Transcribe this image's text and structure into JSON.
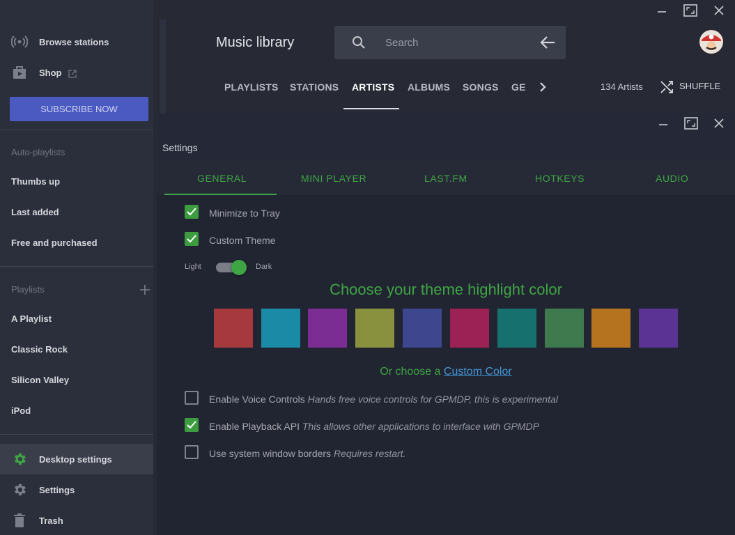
{
  "sidebar": {
    "browse_stations": "Browse stations",
    "shop": "Shop",
    "subscribe": "SUBSCRIBE NOW",
    "auto_playlists_label": "Auto-playlists",
    "auto_playlists": [
      "Thumbs up",
      "Last added",
      "Free and purchased"
    ],
    "playlists_label": "Playlists",
    "playlists": [
      "A Playlist",
      "Classic Rock",
      "Silicon Valley",
      "iPod"
    ],
    "desktop_settings": "Desktop settings",
    "settings": "Settings",
    "trash": "Trash"
  },
  "header": {
    "title": "Music library",
    "search_placeholder": "Search",
    "tabs": [
      "PLAYLISTS",
      "STATIONS",
      "ARTISTS",
      "ALBUMS",
      "SONGS",
      "GE"
    ],
    "active_tab": "ARTISTS",
    "artist_count": "134 Artists",
    "shuffle": "SHUFFLE"
  },
  "settings": {
    "title": "Settings",
    "tabs": [
      "GENERAL",
      "MINI PLAYER",
      "LAST.FM",
      "HOTKEYS",
      "AUDIO"
    ],
    "active_tab": "GENERAL",
    "minimize_to_tray": "Minimize to Tray",
    "custom_theme": "Custom Theme",
    "toggle_light": "Light",
    "toggle_dark": "Dark",
    "choose_heading": "Choose your theme highlight color",
    "or_choose": "Or choose a",
    "custom_color": "Custom Color",
    "voice_controls": "Enable Voice Controls",
    "voice_controls_desc": "Hands free voice controls for GPMDP, this is experimental",
    "playback_api": "Enable Playback API",
    "playback_api_desc": "This allows other applications to interface with GPMDP",
    "system_borders": "Use system window borders",
    "system_borders_desc": "Requires restart.",
    "checkbox_states": {
      "minimize_to_tray": true,
      "custom_theme": true,
      "voice_controls": false,
      "playback_api": true,
      "system_borders": false
    },
    "dark_mode": true,
    "swatch_colors": [
      "#a5393d",
      "#1a8aa6",
      "#7b2d94",
      "#89913e",
      "#3e468d",
      "#9c2256",
      "#16716e",
      "#3f7a4f",
      "#b57320",
      "#5b3395"
    ]
  },
  "colors": {
    "accent": "#3fa544",
    "link": "#4298d8",
    "subscribe": "#4a5ac1"
  }
}
